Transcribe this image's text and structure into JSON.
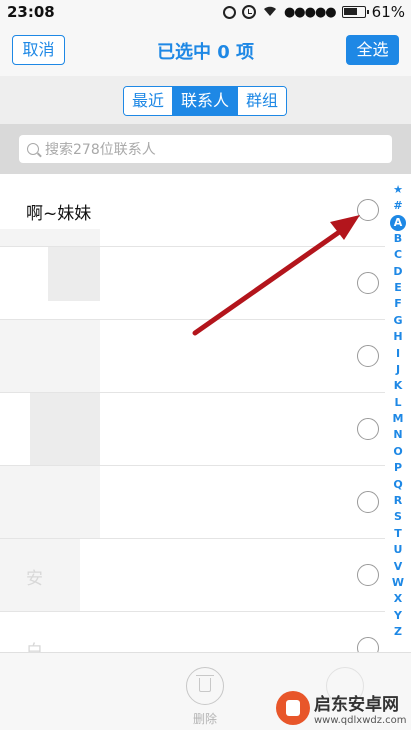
{
  "status_bar": {
    "time": "23:08",
    "signal": "●●●●●",
    "battery_percent": "61%"
  },
  "navbar": {
    "cancel_label": "取消",
    "title": "已选中 0 项",
    "select_all_label": "全选"
  },
  "segmented": {
    "tabs": [
      "最近",
      "联系人",
      "群组"
    ],
    "active_index": 1
  },
  "search": {
    "placeholder": "搜索278位联系人"
  },
  "contacts": [
    {
      "name": "啊~妹妹",
      "selected": false
    },
    {
      "name": "",
      "selected": false
    },
    {
      "name": "",
      "selected": false
    },
    {
      "name": "",
      "selected": false
    },
    {
      "name": "",
      "selected": false
    },
    {
      "name": "安",
      "selected": false
    },
    {
      "name": "白",
      "selected": false
    }
  ],
  "index": [
    "★",
    "#",
    "A",
    "B",
    "C",
    "D",
    "E",
    "F",
    "G",
    "H",
    "I",
    "J",
    "K",
    "L",
    "M",
    "N",
    "O",
    "P",
    "Q",
    "R",
    "S",
    "T",
    "U",
    "V",
    "W",
    "X",
    "Y",
    "Z"
  ],
  "index_active": "A",
  "toolbar": {
    "delete_label": "删除"
  },
  "watermark": {
    "title": "启东安卓网",
    "url": "www.qdlxwdz.com"
  },
  "colors": {
    "accent": "#1e88e5",
    "arrow": "#b3151c"
  }
}
